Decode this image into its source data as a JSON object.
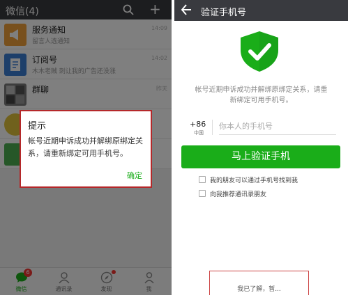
{
  "left": {
    "header": {
      "title": "微信(4)"
    },
    "chats": [
      {
        "name": "服务通知",
        "preview": "留言人选通知",
        "time": "14:09",
        "avatar_color": "#f1a13b"
      },
      {
        "name": "订阅号",
        "preview": "木木老贼 刺让我的广告还没涨",
        "time": "14:02",
        "avatar_color": "#3b7fd4"
      },
      {
        "name": "群聊",
        "preview": "",
        "time": "昨天",
        "avatar_color": "#7b7b7b"
      },
      {
        "name": "",
        "preview": "",
        "time": "",
        "avatar_color": "#e0c23a"
      },
      {
        "name": "",
        "preview": "",
        "time": "",
        "avatar_color": "#4caf50"
      }
    ],
    "dialog": {
      "title": "提示",
      "message": "帐号近期申诉成功并解绑原绑定关系，请重新绑定可用手机号。",
      "ok": "确定"
    },
    "nav": [
      {
        "label": "微信",
        "icon": "chat-icon",
        "badge": "6"
      },
      {
        "label": "通讯录",
        "icon": "contacts-icon"
      },
      {
        "label": "发现",
        "icon": "compass-icon"
      },
      {
        "label": "我",
        "icon": "person-icon"
      }
    ]
  },
  "right": {
    "header": {
      "title": "验证手机号"
    },
    "description": "帐号近期申诉成功并解绑原绑定关系，请重新绑定可用手机号。",
    "country_code": "+86",
    "country_sub": "中国",
    "phone_placeholder": "你本人的手机号",
    "verify_button": "马上验证手机",
    "checkbox1": "我的朋友可以通过手机号找到我",
    "checkbox2": "向我推荐通讯录朋友",
    "footer": "我已了解，暂..."
  },
  "colors": {
    "accent": "#1aad19",
    "header": "#393a3f",
    "highlight": "#b5282a"
  }
}
